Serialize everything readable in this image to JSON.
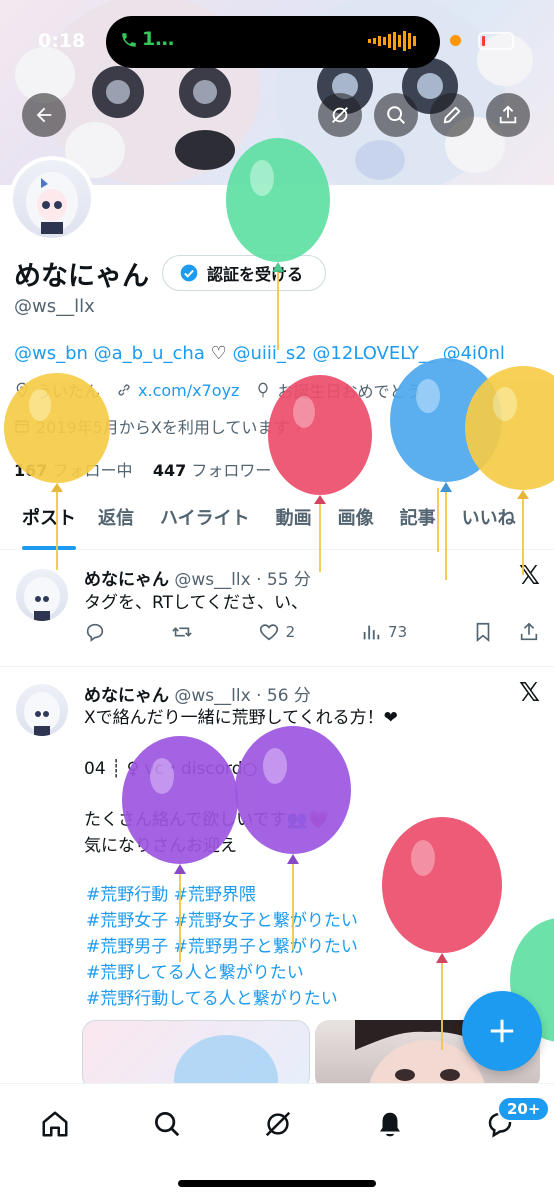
{
  "status_bar": {
    "time": "0:18",
    "call_indicator": "1…"
  },
  "header_buttons": [
    "back-arrow-icon",
    "grok-icon",
    "search-icon",
    "edit-pencil-icon",
    "share-icon"
  ],
  "profile": {
    "name": "めなにゃん",
    "verify_label": "認証を受ける",
    "handle": "@ws__llx",
    "bio_mentions": "@ws_bn @a_b_u_cha",
    "bio_heart": " ♡ ",
    "bio_mentions_2": "@uiii_s2 @12LOVELY__ @4i0nl",
    "location": "ういたん",
    "website": "x.com/x7oyz",
    "birthday": "お誕生日おめでとう",
    "joined": "2019年5月からXを利用しています",
    "following_count": "167",
    "following_label": " フォロー中",
    "followers_count": "447",
    "followers_label": " フォロワー"
  },
  "tabs": [
    "ポスト",
    "返信",
    "ハイライト",
    "動画",
    "画像",
    "記事",
    "いいね"
  ],
  "posts": [
    {
      "name": "めなにゃん",
      "meta": " @ws__llx · 55 分",
      "text": "タグを、RTしてくださ、い、",
      "replies": "",
      "reposts": "",
      "likes": "2",
      "views": "73"
    },
    {
      "name": "めなにゃん",
      "meta": " @ws__llx · 56 分",
      "lines": [
        "Xで絡んだり一緒に荒野してくれる方！❤",
        "",
        "04 ┊ ♀ vc・discord○",
        "",
        "たくさん絡んで欲しいです👥💗",
        "気になりさんお迎え"
      ],
      "hashtags": [
        "#荒野行動 #荒野界隈",
        "#荒野女子 #荒野女子と繋がりたい",
        "#荒野男子 #荒野男子と繋がりたい",
        "#荒野してる人と繋がりたい",
        "#荒野行動してる人と繋がりたい"
      ]
    }
  ],
  "bottom_nav": [
    "home-icon",
    "search-icon",
    "grok-icon",
    "notifications-icon",
    "messages-icon"
  ],
  "messages_badge": "20+",
  "colors": {
    "accent": "#1d9bf0",
    "text": "#0f1419",
    "secondary": "#536471"
  }
}
